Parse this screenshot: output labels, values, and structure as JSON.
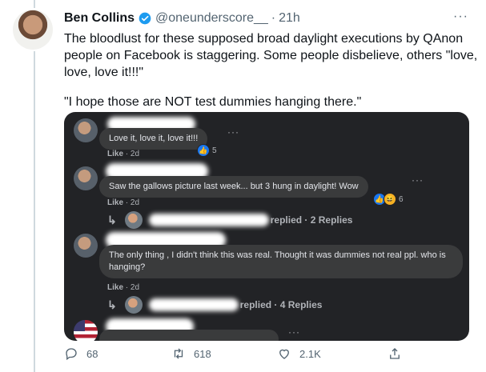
{
  "tweet": {
    "author_name": "Ben Collins",
    "handle": "@oneunderscore__",
    "separator": "·",
    "time": "21h",
    "more": "···",
    "text_p1": "The bloodlust for these supposed broad daylight executions by QAnon people on Facebook is staggering. Some people disbelieve, others \"love, love, love it!!!\"",
    "text_p2": "\"I hope those are NOT test dummies hanging there.\""
  },
  "screenshot": {
    "comments": [
      {
        "text": "Love it, love it, love it!!!",
        "like": "Like",
        "sep": "·",
        "time": "2d",
        "reaction_count": "5"
      },
      {
        "text": "Saw the gallows picture last week... but 3 hung in daylight! Wow",
        "like": "Like",
        "sep": "·",
        "time": "2d",
        "reaction_count": "6",
        "replies_tail": "replied · 2 Replies"
      },
      {
        "text": "The only thing , I didn't think this was real. Thought it was dummies not real ppl. who is hanging?",
        "like": "Like",
        "sep": "·",
        "time": "2d",
        "replies_tail": "replied · 4 Replies"
      }
    ],
    "dots": "···"
  },
  "actions": {
    "reply_count": "68",
    "retweet_count": "618",
    "like_count": "2.1K"
  },
  "colors": {
    "verified": "#1d9bf0",
    "secondary": "#536471",
    "fb_bg": "#222326",
    "fb_bubble": "#3a3b3c"
  }
}
